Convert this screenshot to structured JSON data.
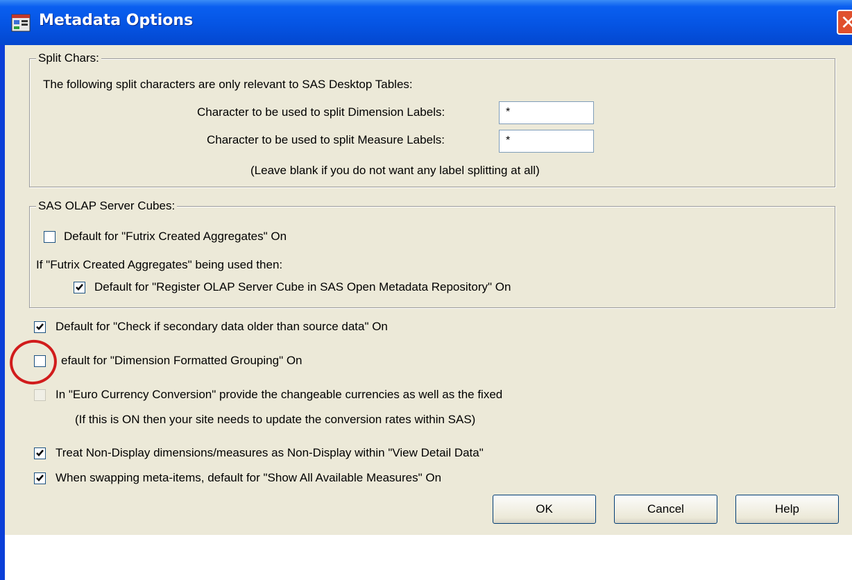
{
  "window": {
    "title": "Metadata Options",
    "title_icon": "app-window-icon",
    "close_icon": "close-x-icon",
    "close_glyph": "✕"
  },
  "split_chars": {
    "legend": "Split Chars:",
    "intro": "The following split characters are only relevant to SAS Desktop Tables:",
    "dimension_label": "Character to be used to split Dimension Labels:",
    "dimension_value": "*",
    "measure_label": "Character to be used to split Measure Labels:",
    "measure_value": "*",
    "note": "(Leave blank if you do not want any label splitting at all)"
  },
  "olap": {
    "legend": "SAS OLAP Server Cubes:",
    "futrix_aggregates": {
      "label": "Default for \"Futrix Created Aggregates\" On",
      "checked": false
    },
    "if_text": "If \"Futrix Created Aggregates\" being used then:",
    "register_cube": {
      "label": "Default for \"Register OLAP Server Cube in SAS Open Metadata Repository\" On",
      "checked": true
    }
  },
  "options": {
    "check_secondary": {
      "label": "Default for \"Check if secondary data older than source data\" On",
      "checked": true
    },
    "dimension_grouping": {
      "label": "efault for \"Dimension Formatted Grouping\" On",
      "checked": false
    },
    "euro_currency": {
      "label": "In \"Euro Currency Conversion\" provide the changeable currencies as well as the fixed",
      "checked": false,
      "enabled": false
    },
    "euro_note": "(If this is ON then your site needs to update the conversion rates within SAS)",
    "non_display": {
      "label": "Treat Non-Display dimensions/measures as Non-Display within \"View Detail Data\"",
      "checked": true
    },
    "swap_meta": {
      "label": "When swapping meta-items, default for \"Show All Available Measures\" On",
      "checked": true
    }
  },
  "buttons": {
    "ok": "OK",
    "cancel": "Cancel",
    "help": "Help"
  },
  "annotation": {
    "color": "#d11c1c"
  }
}
